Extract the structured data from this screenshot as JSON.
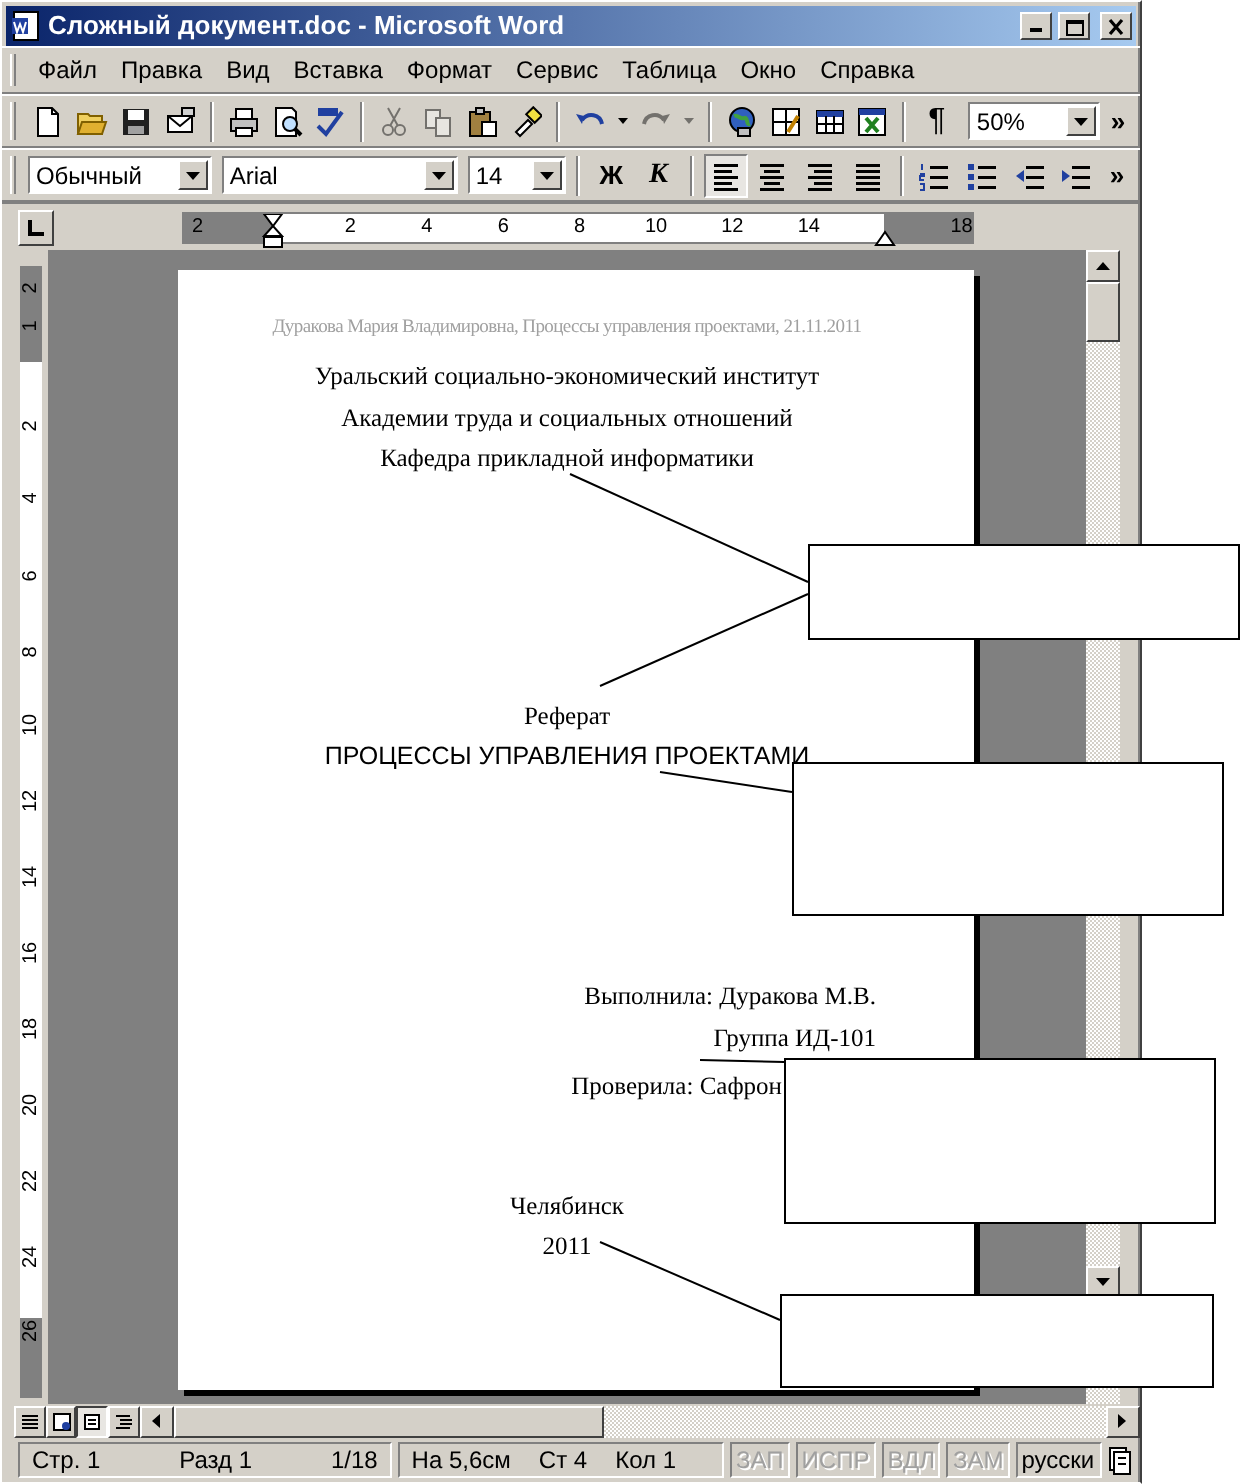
{
  "window": {
    "title": "Сложный документ.doc - Microsoft Word"
  },
  "menu": [
    "Файл",
    "Правка",
    "Вид",
    "Вставка",
    "Формат",
    "Сервис",
    "Таблица",
    "Окно",
    "Справка"
  ],
  "standard_toolbar": {
    "buttons": [
      {
        "disabled": false
      },
      {
        "disabled": false
      },
      {
        "disabled": false
      },
      {
        "disabled": false
      },
      {
        "disabled": false
      },
      {
        "disabled": false
      },
      {
        "disabled": false
      },
      {
        "disabled": true
      },
      {
        "disabled": true
      },
      {
        "disabled": false
      },
      {
        "disabled": false
      },
      {
        "disabled": false
      },
      {
        "disabled": false
      },
      {
        "disabled": true
      },
      {
        "disabled": true
      },
      {
        "disabled": false
      },
      {
        "disabled": false
      },
      {
        "disabled": false
      },
      {
        "disabled": false
      }
    ],
    "pilcrow": "¶",
    "zoom": "50%",
    "more": "»"
  },
  "formatting_toolbar": {
    "style": "Обычный",
    "font": "Arial",
    "size": "14",
    "bold": "Ж",
    "italic": "К",
    "alignment": [
      {
        "selected": true
      },
      {
        "selected": false
      },
      {
        "selected": false
      },
      {
        "selected": false
      }
    ],
    "more": "»"
  },
  "horizontal_ruler": [
    "2",
    "2",
    "4",
    "6",
    "8",
    "10",
    "12",
    "14",
    "18"
  ],
  "vertical_ruler": [
    "2",
    "1",
    "2",
    "4",
    "6",
    "8",
    "10",
    "12",
    "14",
    "16",
    "18",
    "20",
    "22",
    "24",
    "26"
  ],
  "document": {
    "paragraphs": [
      {
        "kind": "header",
        "text": "Дуракова Мария Владимировна, Процессы управления проектами, 21.11.2011"
      },
      {
        "kind": "serif",
        "text": "Уральский социально-экономический институт"
      },
      {
        "kind": "serif",
        "text": "Академии труда и социальных отношений"
      },
      {
        "kind": "serif",
        "text": "Кафедра прикладной информатики"
      },
      {
        "kind": "serif",
        "text": "Реферат"
      },
      {
        "kind": "sans",
        "text": "ПРОЦЕССЫ УПРАВЛЕНИЯ ПРОЕКТАМИ"
      },
      {
        "kind": "signature",
        "text": "Выполнила: Дуракова М.В."
      },
      {
        "kind": "signature",
        "text": "Группа ИД-101"
      },
      {
        "kind": "signature",
        "text": "Проверила: Сафрон"
      },
      {
        "kind": "serif",
        "text": "Челябинск"
      },
      {
        "kind": "serif",
        "text": "2011"
      }
    ]
  },
  "view_buttons": [
    {
      "selected": false
    },
    {
      "selected": false
    },
    {
      "selected": true
    },
    {
      "selected": false
    }
  ],
  "status_bar": {
    "position": [
      {
        "text": "Стр. 1"
      },
      {
        "text": "Разд 1"
      },
      {
        "text": "1/18"
      }
    ],
    "cursor": [
      {
        "text": "На 5,6см"
      },
      {
        "text": "Ст 4"
      },
      {
        "text": "Кол 1"
      }
    ],
    "modes": [
      {
        "text": "ЗАП",
        "disabled": true
      },
      {
        "text": "ИСПР",
        "disabled": true
      },
      {
        "text": "ВДЛ",
        "disabled": true
      },
      {
        "text": "ЗАМ",
        "disabled": true
      }
    ],
    "language": "русски"
  }
}
